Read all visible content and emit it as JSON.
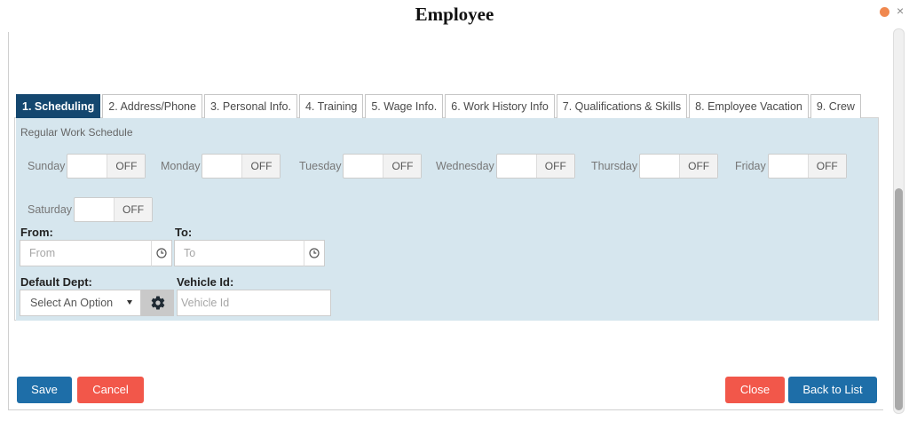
{
  "window": {
    "title": "Employee"
  },
  "tabs": [
    {
      "label": "1. Scheduling",
      "active": true
    },
    {
      "label": "2. Address/Phone"
    },
    {
      "label": "3. Personal Info."
    },
    {
      "label": "4. Training"
    },
    {
      "label": "5. Wage Info."
    },
    {
      "label": "6. Work History Info"
    },
    {
      "label": "7. Qualifications & Skills"
    },
    {
      "label": "8. Employee Vacation"
    },
    {
      "label": "9. Crew"
    }
  ],
  "schedule": {
    "section_label": "Regular Work Schedule",
    "days": [
      {
        "label": "Sunday",
        "state": "OFF"
      },
      {
        "label": "Monday",
        "state": "OFF"
      },
      {
        "label": "Tuesday",
        "state": "OFF"
      },
      {
        "label": "Wednesday",
        "state": "OFF"
      },
      {
        "label": "Thursday",
        "state": "OFF"
      },
      {
        "label": "Friday",
        "state": "OFF"
      },
      {
        "label": "Saturday",
        "state": "OFF"
      }
    ]
  },
  "form": {
    "from_label": "From:",
    "from_placeholder": "From",
    "to_label": "To:",
    "to_placeholder": "To",
    "dept_label": "Default Dept:",
    "dept_value": "Select An Option",
    "vehicle_label": "Vehicle Id:",
    "vehicle_placeholder": "Vehicle Id"
  },
  "buttons": {
    "save": "Save",
    "cancel": "Cancel",
    "close": "Close",
    "back": "Back to List"
  },
  "colors": {
    "active_tab": "#14476f",
    "panel_bg": "#d6e6ee",
    "primary_button": "#1e6ea8",
    "danger_button": "#f2574a"
  }
}
